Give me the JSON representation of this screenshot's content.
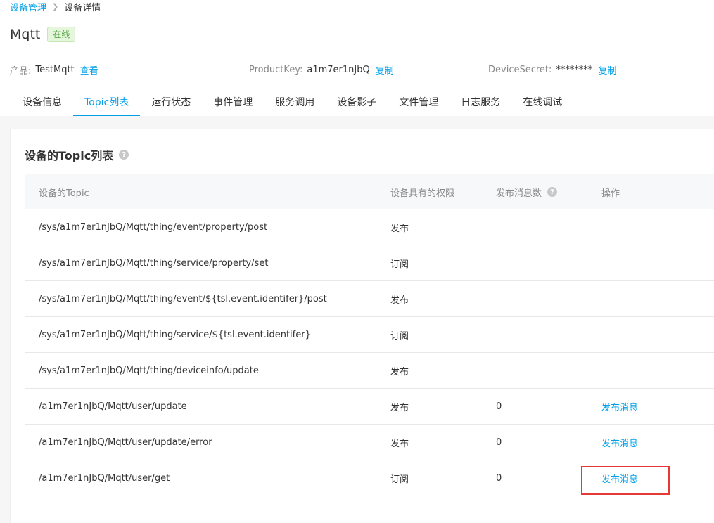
{
  "breadcrumb": {
    "parent": "设备管理",
    "current": "设备详情"
  },
  "device": {
    "name": "Mqtt",
    "status": "在线"
  },
  "info": {
    "product_label": "产品:",
    "product_value": "TestMqtt",
    "product_link": "查看",
    "productkey_label": "ProductKey:",
    "productkey_value": "a1m7er1nJbQ",
    "productkey_link": "复制",
    "devicesecret_label": "DeviceSecret:",
    "devicesecret_value": "********",
    "devicesecret_link": "复制"
  },
  "tabs": [
    {
      "label": "设备信息"
    },
    {
      "label": "Topic列表"
    },
    {
      "label": "运行状态"
    },
    {
      "label": "事件管理"
    },
    {
      "label": "服务调用"
    },
    {
      "label": "设备影子"
    },
    {
      "label": "文件管理"
    },
    {
      "label": "日志服务"
    },
    {
      "label": "在线调试"
    }
  ],
  "panel": {
    "title": "设备的Topic列表"
  },
  "table": {
    "headers": {
      "topic": "设备的Topic",
      "permission": "设备具有的权限",
      "count": "发布消息数",
      "action": "操作"
    },
    "rows": [
      {
        "topic": "/sys/a1m7er1nJbQ/Mqtt/thing/event/property/post",
        "permission": "发布",
        "count": "",
        "action": ""
      },
      {
        "topic": "/sys/a1m7er1nJbQ/Mqtt/thing/service/property/set",
        "permission": "订阅",
        "count": "",
        "action": ""
      },
      {
        "topic": "/sys/a1m7er1nJbQ/Mqtt/thing/event/${tsl.event.identifer}/post",
        "permission": "发布",
        "count": "",
        "action": ""
      },
      {
        "topic": "/sys/a1m7er1nJbQ/Mqtt/thing/service/${tsl.event.identifer}",
        "permission": "订阅",
        "count": "",
        "action": ""
      },
      {
        "topic": "/sys/a1m7er1nJbQ/Mqtt/thing/deviceinfo/update",
        "permission": "发布",
        "count": "",
        "action": ""
      },
      {
        "topic": "/a1m7er1nJbQ/Mqtt/user/update",
        "permission": "发布",
        "count": "0",
        "action": "发布消息"
      },
      {
        "topic": "/a1m7er1nJbQ/Mqtt/user/update/error",
        "permission": "发布",
        "count": "0",
        "action": "发布消息"
      },
      {
        "topic": "/a1m7er1nJbQ/Mqtt/user/get",
        "permission": "订阅",
        "count": "0",
        "action": "发布消息"
      }
    ]
  },
  "icons": {
    "help": "help-icon",
    "chevron": "chevron-right-icon"
  },
  "colors": {
    "accent": "#00a0e9",
    "online": "#52a542",
    "highlight": "#e53935"
  }
}
